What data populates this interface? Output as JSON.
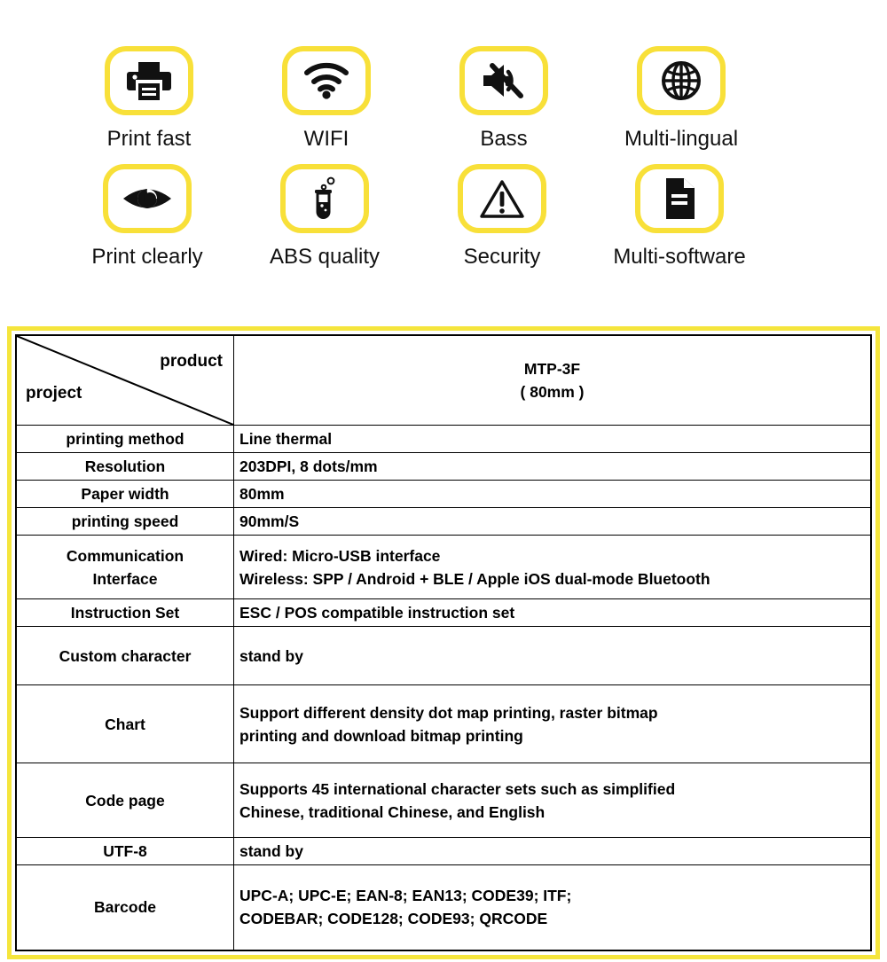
{
  "features": [
    {
      "icon": "printer-icon",
      "label": "Print fast"
    },
    {
      "icon": "wifi-icon",
      "label": "WIFI"
    },
    {
      "icon": "speaker-mute-icon",
      "label": "Bass"
    },
    {
      "icon": "globe-icon",
      "label": "Multi-lingual"
    },
    {
      "icon": "eye-icon",
      "label": "Print clearly"
    },
    {
      "icon": "test-tube-icon",
      "label": "ABS quality"
    },
    {
      "icon": "warning-triangle-icon",
      "label": "Security"
    },
    {
      "icon": "document-icon",
      "label": "Multi-software"
    }
  ],
  "table": {
    "corner": {
      "product_label": "product",
      "project_label": "project"
    },
    "model": {
      "name": "MTP-3F",
      "paper": "( 80mm )"
    },
    "rows": [
      {
        "label": "printing method",
        "value_lines": [
          "Line thermal"
        ]
      },
      {
        "label": "Resolution",
        "value_lines": [
          "203DPI, 8 dots/mm"
        ]
      },
      {
        "label": "Paper width",
        "value_lines": [
          "80mm"
        ]
      },
      {
        "label": "printing speed",
        "value_lines": [
          "90mm/S"
        ]
      },
      {
        "label_lines": [
          "Communication",
          "Interface"
        ],
        "value_lines": [
          "Wired: Micro-USB interface",
          "Wireless: SPP / Android + BLE / Apple iOS dual-mode Bluetooth"
        ]
      },
      {
        "label": "Instruction Set",
        "value_lines": [
          "ESC / POS compatible instruction set"
        ]
      },
      {
        "label": "Custom character",
        "value_lines": [
          "stand by"
        ]
      },
      {
        "label": "Chart",
        "value_lines": [
          "Support different density dot map printing, raster bitmap",
          "printing and download bitmap printing"
        ]
      },
      {
        "label": "Code page",
        "value_lines": [
          "Supports 45 international character sets such as simplified",
          "Chinese, traditional Chinese, and English"
        ]
      },
      {
        "label": "UTF-8",
        "value_lines": [
          "stand by"
        ]
      },
      {
        "label": "Barcode",
        "value_lines": [
          "UPC-A; UPC-E; EAN-8; EAN13; CODE39; ITF;",
          "CODEBAR; CODE128; CODE93; QRCODE"
        ]
      }
    ]
  },
  "colors": {
    "accent_yellow": "#F5E53C",
    "icon_border": "#F8E039",
    "text_black": "#000000",
    "background": "#FFFFFF"
  }
}
